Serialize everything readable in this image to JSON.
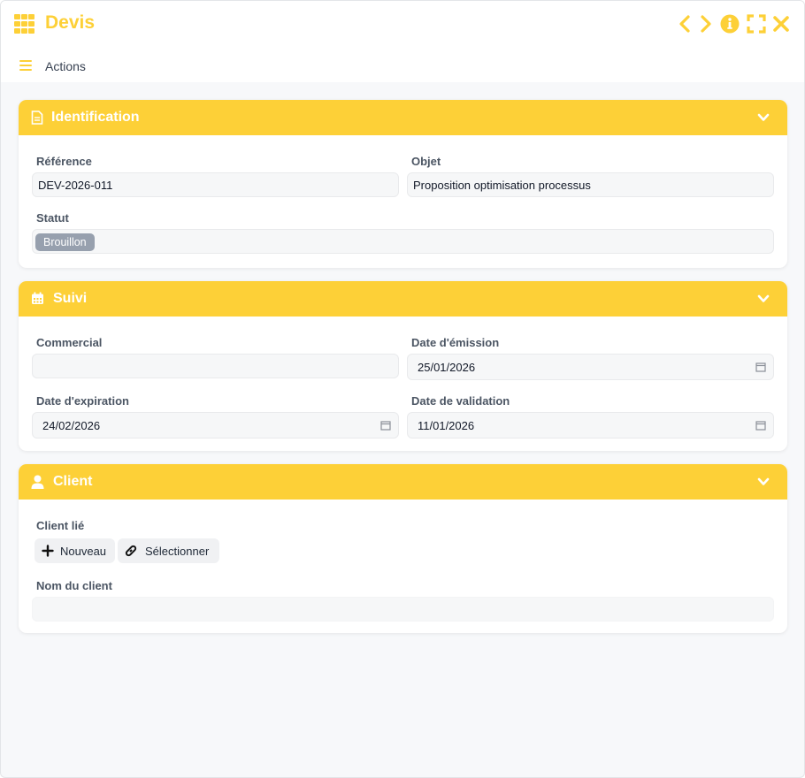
{
  "window": {
    "title": "Devis",
    "accent_color": "#fdd037",
    "controls": [
      "chevron-left-icon",
      "chevron-right-icon",
      "info-icon",
      "fullscreen-icon",
      "close-icon"
    ]
  },
  "toolbar": {
    "actions_label": "Actions"
  },
  "identification": {
    "title": "Identification",
    "reference_label": "Référence",
    "reference_value": "DEV-2026-011",
    "objet_label": "Objet",
    "objet_value": "Proposition optimisation processus",
    "statut_label": "Statut",
    "statut_value": "Brouillon"
  },
  "suivi": {
    "title": "Suivi",
    "commercial_label": "Commercial",
    "commercial_value": "",
    "date_emission_label": "Date d'émission",
    "date_emission_value": "25/01/2026",
    "date_expiration_label": "Date d'expiration",
    "date_expiration_value": "24/02/2026",
    "date_validation_label": "Date de validation",
    "date_validation_value": "11/01/2026"
  },
  "client": {
    "title": "Client",
    "client_lie_label": "Client lié",
    "nouveau_label": "Nouveau",
    "selectionner_label": "Sélectionner",
    "nom_label": "Nom du client",
    "nom_value": ""
  }
}
